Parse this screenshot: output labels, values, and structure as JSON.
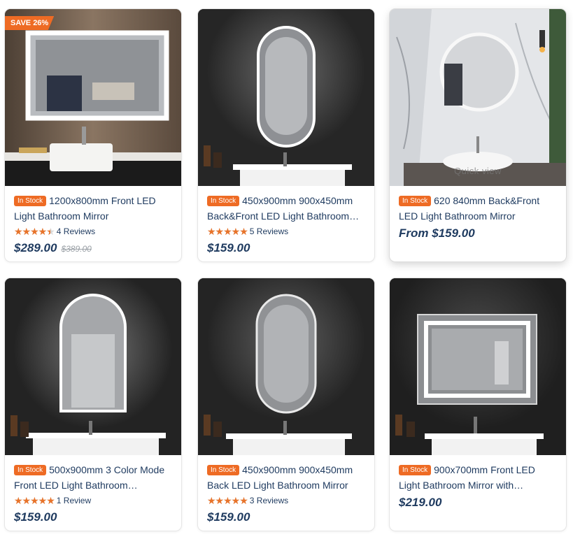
{
  "products": [
    {
      "badge": "SAVE 26%",
      "stock": "In Stock",
      "title": "1200x800mm Front LED Light Bathroom Mirror",
      "rating": 4.5,
      "reviews": "4 Reviews",
      "price": "$289.00",
      "old_price": "$389.00"
    },
    {
      "stock": "In Stock",
      "title": "450x900mm 900x450mm Back&Front LED Light Bathroom…",
      "rating": 5,
      "reviews": "5 Reviews",
      "price": "$159.00"
    },
    {
      "stock": "In Stock",
      "title": "620 840mm Back&Front LED Light Bathroom Mirror",
      "price": "From $159.00",
      "quick_view": "Quick view"
    },
    {
      "stock": "In Stock",
      "title": "500x900mm 3 Color Mode Front LED Light Bathroom…",
      "rating": 5,
      "reviews": "1 Review",
      "price": "$159.00"
    },
    {
      "stock": "In Stock",
      "title": "450x900mm 900x450mm Back LED Light Bathroom Mirror",
      "rating": 5,
      "reviews": "3 Reviews",
      "price": "$159.00"
    },
    {
      "stock": "In Stock",
      "title": "900x700mm Front LED Light Bathroom Mirror with…",
      "price": "$219.00"
    }
  ]
}
